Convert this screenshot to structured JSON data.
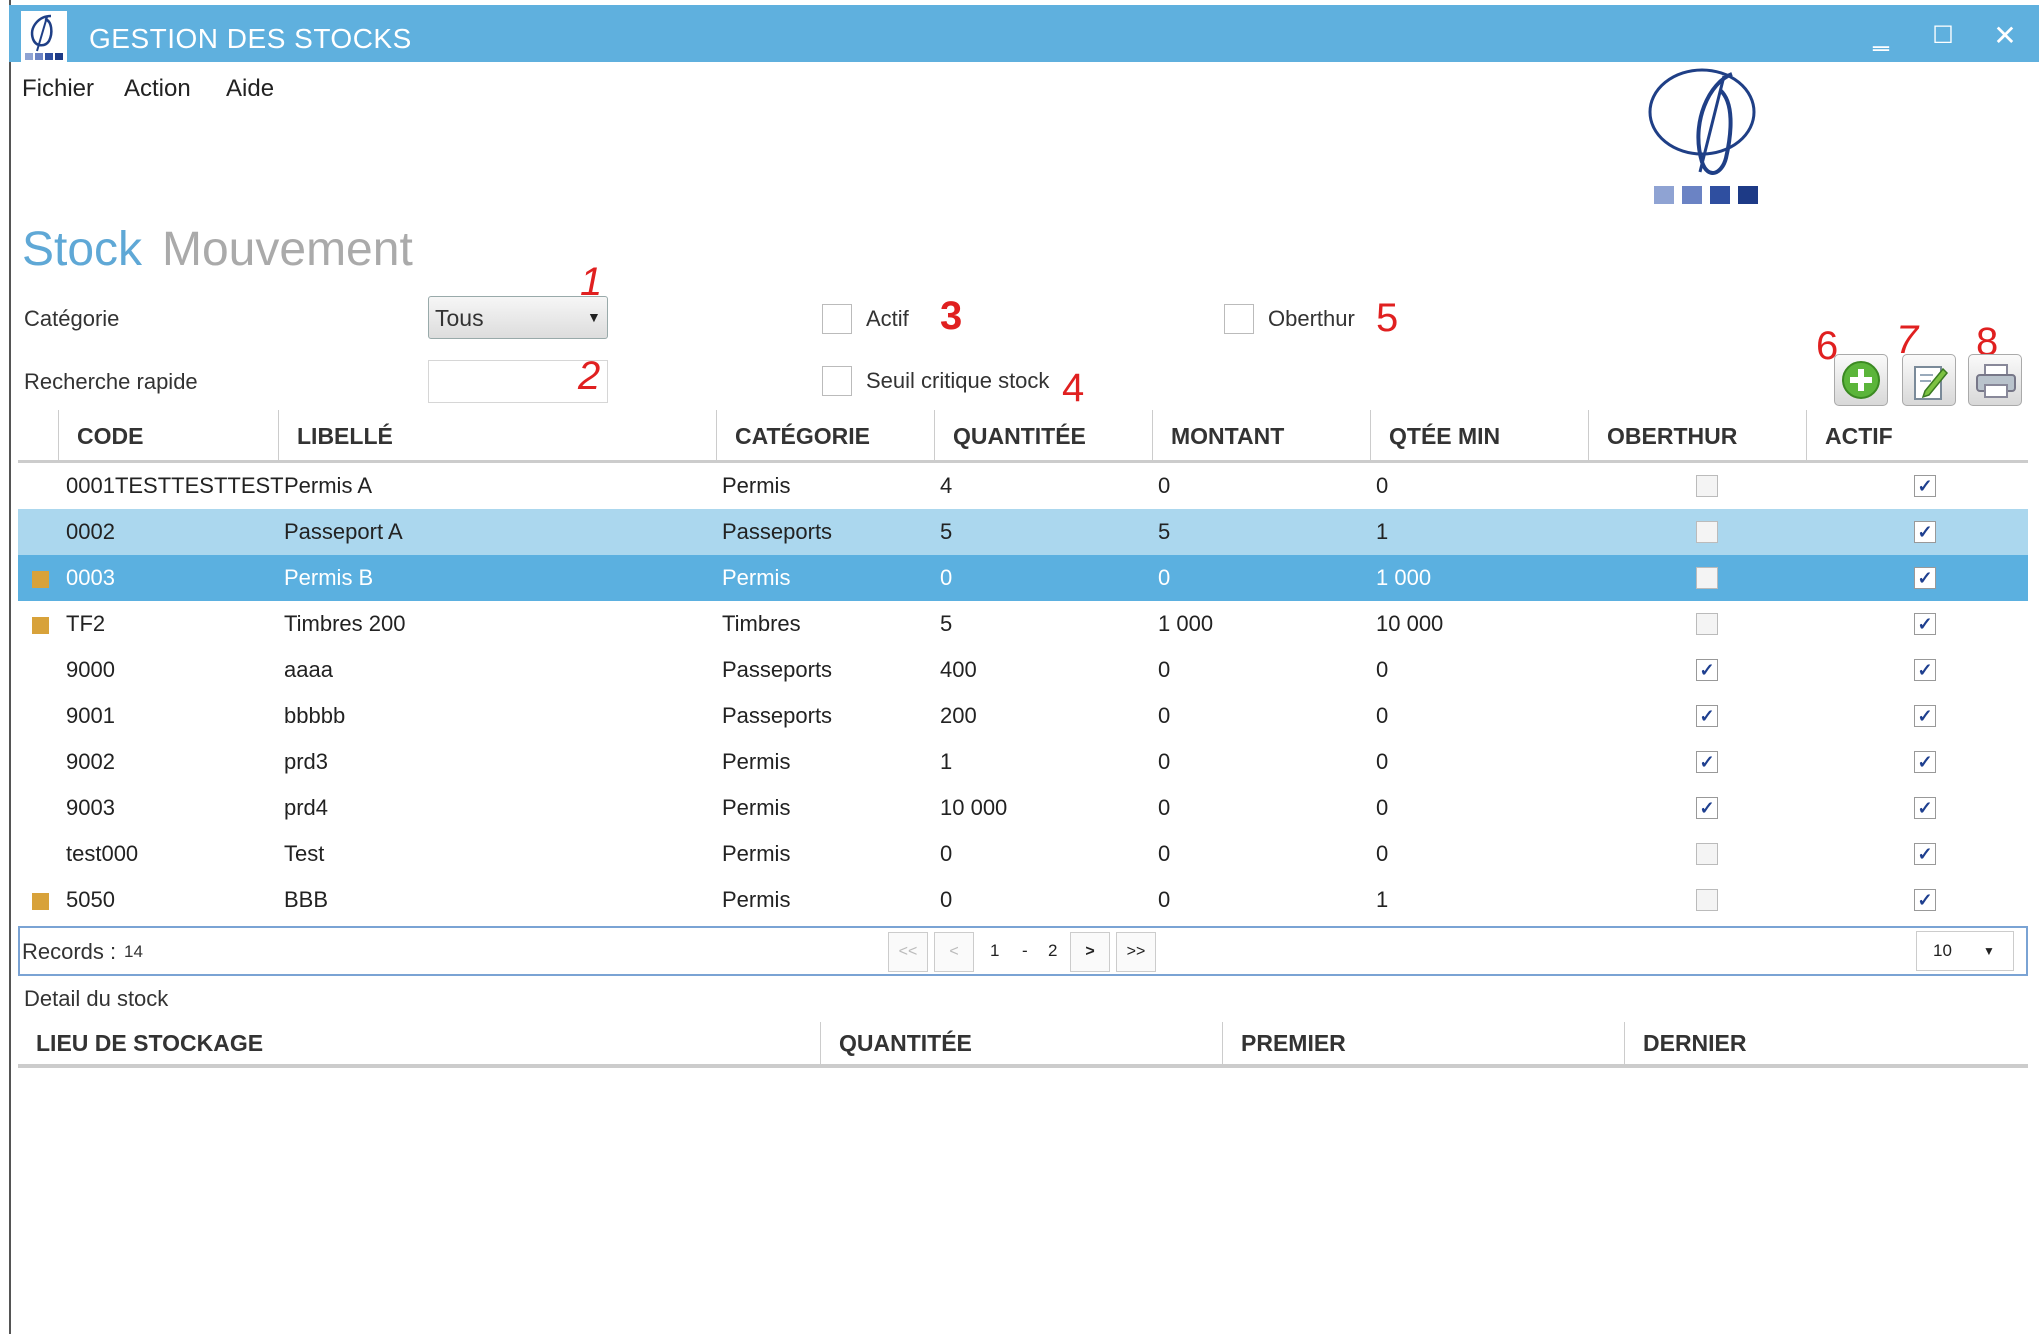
{
  "window": {
    "title": "GESTION DES STOCKS",
    "minimize": "‗",
    "maximize": "☐",
    "close": "✕"
  },
  "menu": [
    "Fichier",
    "Action",
    "Aide"
  ],
  "tabs": {
    "stock": "Stock",
    "mouvement": "Mouvement"
  },
  "filters": {
    "categorie_label": "Catégorie",
    "categorie_value": "Tous",
    "recherche_label": "Recherche rapide",
    "recherche_value": "",
    "actif_label": "Actif",
    "seuil_label": "Seuil critique stock",
    "oberthur_label": "Oberthur"
  },
  "annotations": [
    "1",
    "2",
    "3",
    "4",
    "5",
    "6",
    "7",
    "8"
  ],
  "toolbar": {
    "add": "add-icon",
    "edit": "edit-icon",
    "print": "print-icon"
  },
  "grid": {
    "headers": [
      "CODE",
      "LIBELLÉ",
      "CATÉGORIE",
      "QUANTITÉE",
      "MONTANT",
      "QTÉE MIN",
      "OBERTHUR",
      "ACTIF"
    ],
    "rows": [
      {
        "marker": false,
        "code": "0001TESTTESTTEST",
        "libelle": "Permis A",
        "categorie": "Permis",
        "quantite": "4",
        "montant": "0",
        "qtee_min": "0",
        "oberthur": false,
        "actif": true,
        "state": "normal"
      },
      {
        "marker": false,
        "code": "0002",
        "libelle": "Passeport A",
        "categorie": "Passeports",
        "quantite": "5",
        "montant": "5",
        "qtee_min": "1",
        "oberthur": false,
        "actif": true,
        "state": "hover"
      },
      {
        "marker": true,
        "code": "0003",
        "libelle": "Permis B",
        "categorie": "Permis",
        "quantite": "0",
        "montant": "0",
        "qtee_min": "1 000",
        "oberthur": false,
        "actif": true,
        "state": "selected"
      },
      {
        "marker": true,
        "code": "TF2",
        "libelle": "Timbres 200",
        "categorie": "Timbres",
        "quantite": "5",
        "montant": "1 000",
        "qtee_min": "10 000",
        "oberthur": false,
        "actif": true,
        "state": "normal"
      },
      {
        "marker": false,
        "code": "9000",
        "libelle": "aaaa",
        "categorie": "Passeports",
        "quantite": "400",
        "montant": "0",
        "qtee_min": "0",
        "oberthur": true,
        "actif": true,
        "state": "normal"
      },
      {
        "marker": false,
        "code": "9001",
        "libelle": "bbbbb",
        "categorie": "Passeports",
        "quantite": "200",
        "montant": "0",
        "qtee_min": "0",
        "oberthur": true,
        "actif": true,
        "state": "normal"
      },
      {
        "marker": false,
        "code": "9002",
        "libelle": "prd3",
        "categorie": "Permis",
        "quantite": "1",
        "montant": "0",
        "qtee_min": "0",
        "oberthur": true,
        "actif": true,
        "state": "normal"
      },
      {
        "marker": false,
        "code": "9003",
        "libelle": "prd4",
        "categorie": "Permis",
        "quantite": "10 000",
        "montant": "0",
        "qtee_min": "0",
        "oberthur": true,
        "actif": true,
        "state": "normal"
      },
      {
        "marker": false,
        "code": "test000",
        "libelle": "Test",
        "categorie": "Permis",
        "quantite": "0",
        "montant": "0",
        "qtee_min": "0",
        "oberthur": false,
        "actif": true,
        "state": "normal"
      },
      {
        "marker": true,
        "code": "5050",
        "libelle": "BBB",
        "categorie": "Permis",
        "quantite": "0",
        "montant": "0",
        "qtee_min": "1",
        "oberthur": false,
        "actif": true,
        "state": "normal"
      }
    ]
  },
  "pager": {
    "records_label": "Records :",
    "records_count": "14",
    "first": "<<",
    "prev": "<",
    "page_current": "1",
    "separator": "-",
    "page_total": "2",
    "next": ">",
    "last": ">>",
    "page_size": "10"
  },
  "detail": {
    "title": "Detail du stock",
    "headers": [
      "LIEU DE STOCKAGE",
      "QUANTITÉE",
      "PREMIER",
      "DERNIER"
    ]
  },
  "colors": {
    "titlebar": "#5fb0de",
    "row_hover": "#abd7ee",
    "row_selected": "#5bb0e0",
    "marker": "#d8a23a",
    "annotation": "#e02020",
    "tab_active": "#5fa8d6",
    "tab_inactive": "#aaaaaa"
  }
}
